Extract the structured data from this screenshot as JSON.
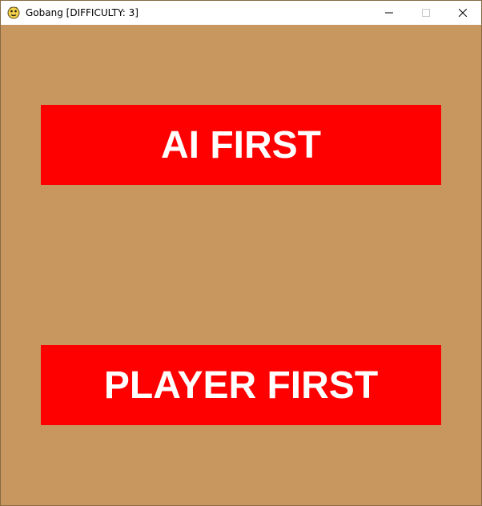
{
  "window": {
    "title": "Gobang [DIFFICULTY: 3]"
  },
  "icons": {
    "app": "python-snake-icon",
    "minimize": "minimize-icon",
    "maximize": "maximize-icon",
    "close": "close-icon"
  },
  "colors": {
    "board_background": "#c8965f",
    "button_background": "#ff0000",
    "button_text": "#ffffff"
  },
  "menu": {
    "ai_first_label": "AI FIRST",
    "player_first_label": "PLAYER FIRST"
  }
}
